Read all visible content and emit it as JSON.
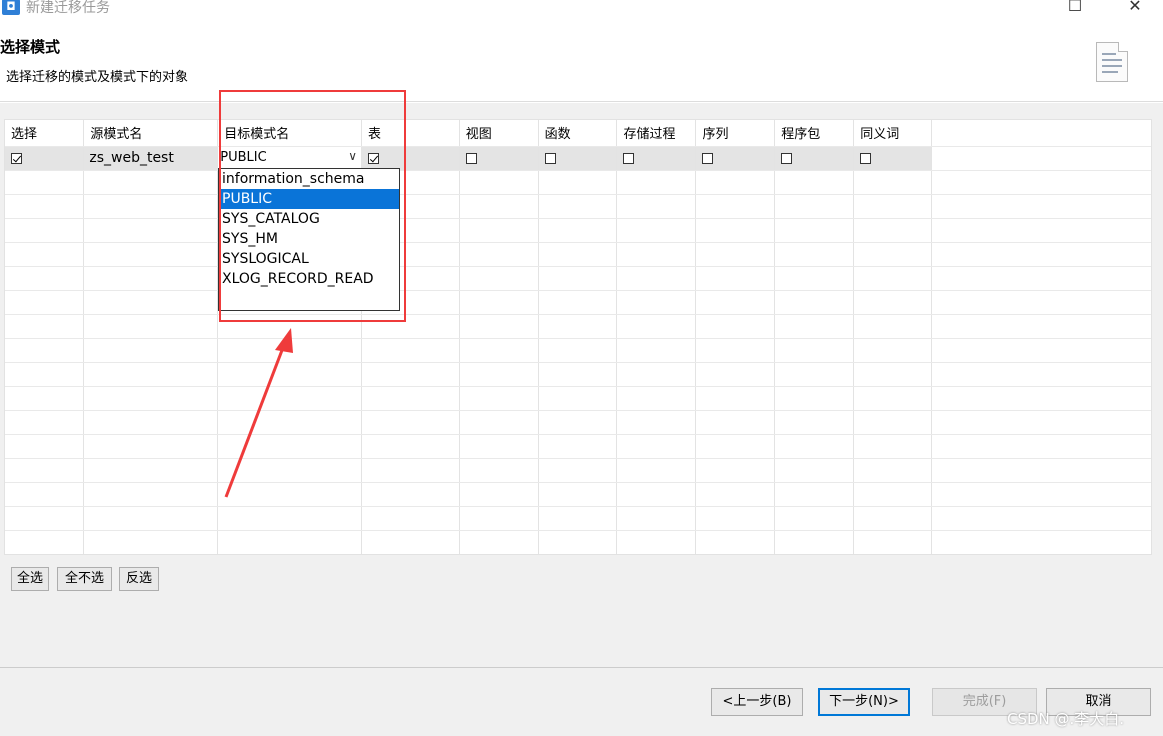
{
  "window": {
    "title": "新建迁移任务",
    "maximize_glyph": "☐",
    "close_glyph": "✕"
  },
  "header": {
    "title": "选择模式",
    "description": "选择迁移的模式及模式下的对象",
    "icon": "document-icon"
  },
  "grid": {
    "columns": [
      "选择",
      "源模式名",
      "目标模式名",
      "表",
      "视图",
      "函数",
      "存储过程",
      "序列",
      "程序包",
      "同义词"
    ],
    "rows": [
      {
        "select": true,
        "source_schema": "zs_web_test",
        "target_schema": "PUBLIC",
        "table": true,
        "view": false,
        "function": false,
        "procedure": false,
        "sequence": false,
        "package": false,
        "synonym": false
      }
    ]
  },
  "dropdown": {
    "options": [
      "information_schema",
      "PUBLIC",
      "SYS_CATALOG",
      "SYS_HM",
      "SYSLOGICAL",
      "XLOG_RECORD_READ"
    ],
    "selected_index": 1,
    "arrow_glyph": "∨"
  },
  "selection_buttons": {
    "select_all": "全选",
    "select_none": "全不选",
    "invert": "反选"
  },
  "footer": {
    "back": "<上一步(B)",
    "next": "下一步(N)>",
    "finish": "完成(F)",
    "cancel": "取消"
  },
  "annotation": {
    "color": "#ef3b3b"
  },
  "watermark": "CSDN @.李大白."
}
